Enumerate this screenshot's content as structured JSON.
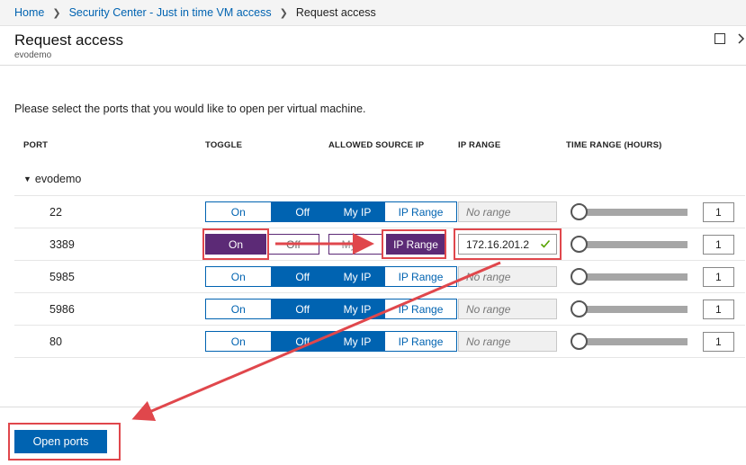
{
  "breadcrumb": {
    "items": [
      "Home",
      "Security Center - Just in time VM access"
    ],
    "current": "Request access"
  },
  "blade": {
    "title": "Request access",
    "subtitle": "evodemo"
  },
  "instructions": "Please select the ports that you would like to open per virtual machine.",
  "table": {
    "headers": {
      "port": "PORT",
      "toggle": "TOGGLE",
      "source": "ALLOWED SOURCE IP",
      "ip_range": "IP RANGE",
      "time_range": "TIME RANGE (HOURS)"
    },
    "group": "evodemo",
    "rows": [
      {
        "port": "22",
        "on": "On",
        "off": "Off",
        "my_ip": "My IP",
        "ip_range_opt": "IP Range",
        "range": "No range",
        "hours": "1",
        "toggle_state": "off",
        "source_state": "my_ip"
      },
      {
        "port": "3389",
        "on": "On",
        "off": "Off",
        "my_ip": "My IP",
        "ip_range_opt": "IP Range",
        "range": "172.16.201.2",
        "hours": "1",
        "toggle_state": "on",
        "source_state": "ip_range"
      },
      {
        "port": "5985",
        "on": "On",
        "off": "Off",
        "my_ip": "My IP",
        "ip_range_opt": "IP Range",
        "range": "No range",
        "hours": "1",
        "toggle_state": "off",
        "source_state": "my_ip"
      },
      {
        "port": "5986",
        "on": "On",
        "off": "Off",
        "my_ip": "My IP",
        "ip_range_opt": "IP Range",
        "range": "No range",
        "hours": "1",
        "toggle_state": "off",
        "source_state": "my_ip"
      },
      {
        "port": "80",
        "on": "On",
        "off": "Off",
        "my_ip": "My IP",
        "ip_range_opt": "IP Range",
        "range": "No range",
        "hours": "1",
        "toggle_state": "off",
        "source_state": "my_ip"
      }
    ]
  },
  "footer": {
    "open_ports_label": "Open ports"
  },
  "colors": {
    "accent": "#0063b1",
    "highlight": "#5c2a76",
    "annotation": "#e0474c"
  }
}
